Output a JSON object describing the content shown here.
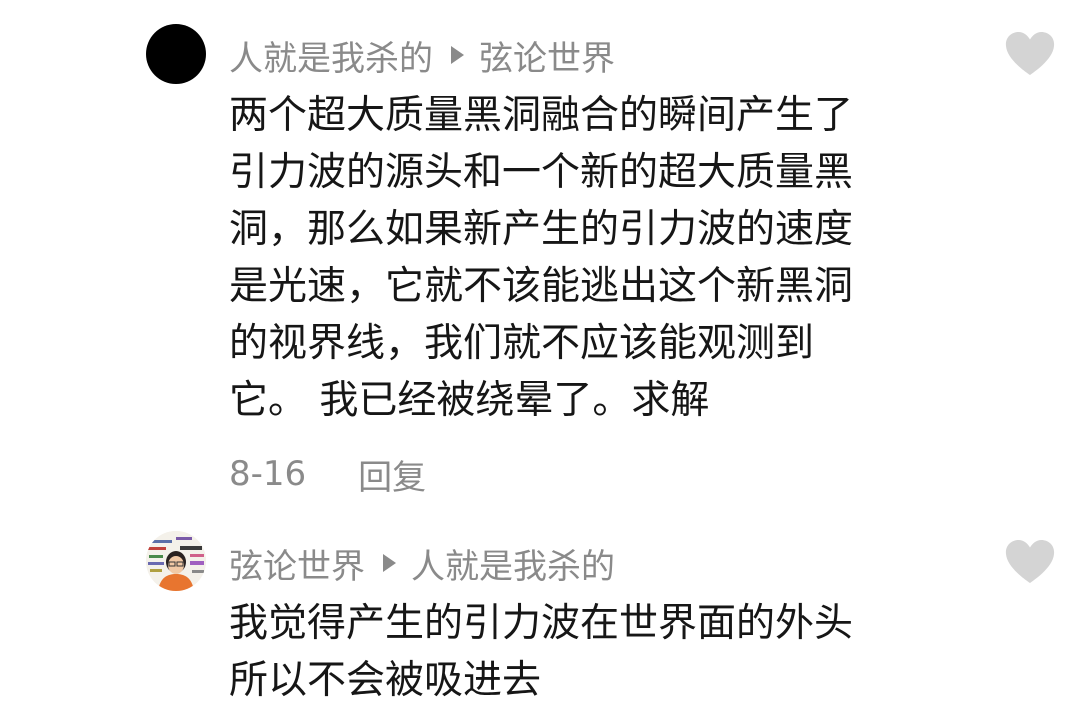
{
  "comments": [
    {
      "author": "人就是我杀的",
      "reply_to": "弦论世界",
      "text": "两个超大质量黑洞融合的瞬间产生了\n引力波的源头和一个新的超大质量黑\n洞，那么如果新产生的引力波的速度\n是光速，它就不该能逃出这个新黑洞\n的视界线，我们就不应该能观测到\n它。 我已经被绕晕了。求解",
      "date": "8-16",
      "reply_label": "回复"
    },
    {
      "author": "弦论世界",
      "reply_to": "人就是我杀的",
      "text": "我觉得产生的引力波在世界面的外头\n所以不会被吸进去"
    }
  ],
  "icons": {
    "reply_arrow": "play-triangle-icon",
    "like": "heart-icon"
  },
  "colors": {
    "text_primary": "#161616",
    "text_secondary": "#8a8a8a",
    "like_heart": "#d4d4d4",
    "avatar_1": "#000000",
    "avatar_2_accent": "#e8752f"
  }
}
